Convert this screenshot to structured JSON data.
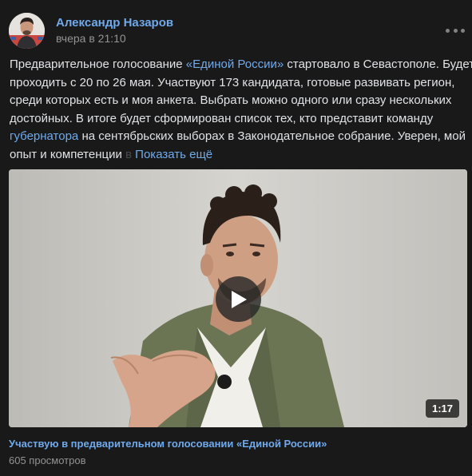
{
  "header": {
    "author_name": "Александр Назаров",
    "timestamp": "вчера в 21:10",
    "more_icon": "ellipsis-icon"
  },
  "post": {
    "line1_a": "Предварительное голосование ",
    "line1_link": "«Единой России»",
    "line1_b": " стартовало в Севастополе. Будет",
    "line2": "проходить с 20 по 26 мая. Участвуют 173 кандидата, готовые развивать регион,",
    "line3": "среди которых есть и моя анкета. Выбрать можно одного или сразу нескольких",
    "line4": "достойных. В итоге будет сформирован список тех, кто представит команду",
    "line5_link": "губернатора",
    "line5_b": " на сентябрьских выборах в Законодательное собрание. Уверен, мой",
    "line6_a": "опыт и компетенции ",
    "line6_fade": "в",
    "show_more": "Показать ещё"
  },
  "video": {
    "duration": "1:17",
    "title": "Участвую в предварительном голосовании «Единой России»",
    "views": "605 просмотров",
    "play_icon": "play-icon"
  },
  "colors": {
    "background": "#19191a",
    "link": "#71aaeb",
    "text": "#e1e3e6",
    "secondary": "#939393"
  }
}
